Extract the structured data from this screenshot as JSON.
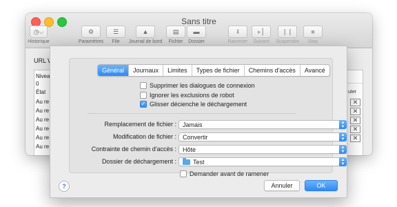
{
  "window": {
    "title": "Sans titre",
    "toolbar": [
      {
        "label": "Historique",
        "icon": "clock-icon",
        "glyph": "◷⌵",
        "enabled": true
      },
      {
        "label": "Paramètres",
        "icon": "gear-icon",
        "glyph": "⚙",
        "enabled": true
      },
      {
        "label": "File",
        "icon": "list-icon",
        "glyph": "☰",
        "enabled": true
      },
      {
        "label": "Journal de bord",
        "icon": "warning-icon",
        "glyph": "▲",
        "enabled": true
      },
      {
        "label": "Fichier",
        "icon": "document-icon",
        "glyph": "▤",
        "enabled": true
      },
      {
        "label": "Dossier",
        "icon": "folder-icon",
        "glyph": "▬",
        "enabled": true
      },
      {
        "label": "Ramener",
        "icon": "download-icon",
        "glyph": "⬇",
        "enabled": false
      },
      {
        "label": "Suivant",
        "icon": "skip-icon",
        "glyph": "▸┃",
        "enabled": false
      },
      {
        "label": "Suspendre",
        "icon": "pause-icon",
        "glyph": "❙❙",
        "enabled": false
      },
      {
        "label": "Stop",
        "icon": "stop-icon",
        "glyph": "■",
        "enabled": false
      }
    ],
    "url_label": "URL W",
    "table_cells": [
      "Nivea",
      "0",
      "État",
      "Au re",
      "Au re",
      "Au re",
      "Au re",
      "Au re",
      "Au re"
    ],
    "right_column_label": "uter",
    "right_column_marks": [
      "✕",
      "✕",
      "✕",
      "✕",
      "✕"
    ]
  },
  "sheet": {
    "tabs": [
      {
        "label": "Général",
        "active": true
      },
      {
        "label": "Journaux",
        "active": false
      },
      {
        "label": "Limites",
        "active": false
      },
      {
        "label": "Types de fichier",
        "active": false
      },
      {
        "label": "Chemins d'accès",
        "active": false
      },
      {
        "label": "Avancé",
        "active": false
      }
    ],
    "checkboxes": [
      {
        "label": "Supprimer les dialogues de connexion",
        "checked": false
      },
      {
        "label": "Ignorer les exclusions de robot",
        "checked": false
      },
      {
        "label": "Glisser décienche le déchargement",
        "checked": true
      }
    ],
    "fields": [
      {
        "label": "Remplacement de fichier :",
        "value": "Jamais"
      },
      {
        "label": "Modification de fichier :",
        "value": "Convertir"
      },
      {
        "label": "Contrainte de chemin d'accès :",
        "value": "Hôte"
      },
      {
        "label": "Dossier de déchargement :",
        "value": "Test"
      }
    ],
    "ask_before_fetch": {
      "label": "Demander avant de ramener",
      "checked": false
    },
    "help_label": "?",
    "cancel_label": "Annuler",
    "ok_label": "OK",
    "accent_color": "#2f8af3"
  }
}
